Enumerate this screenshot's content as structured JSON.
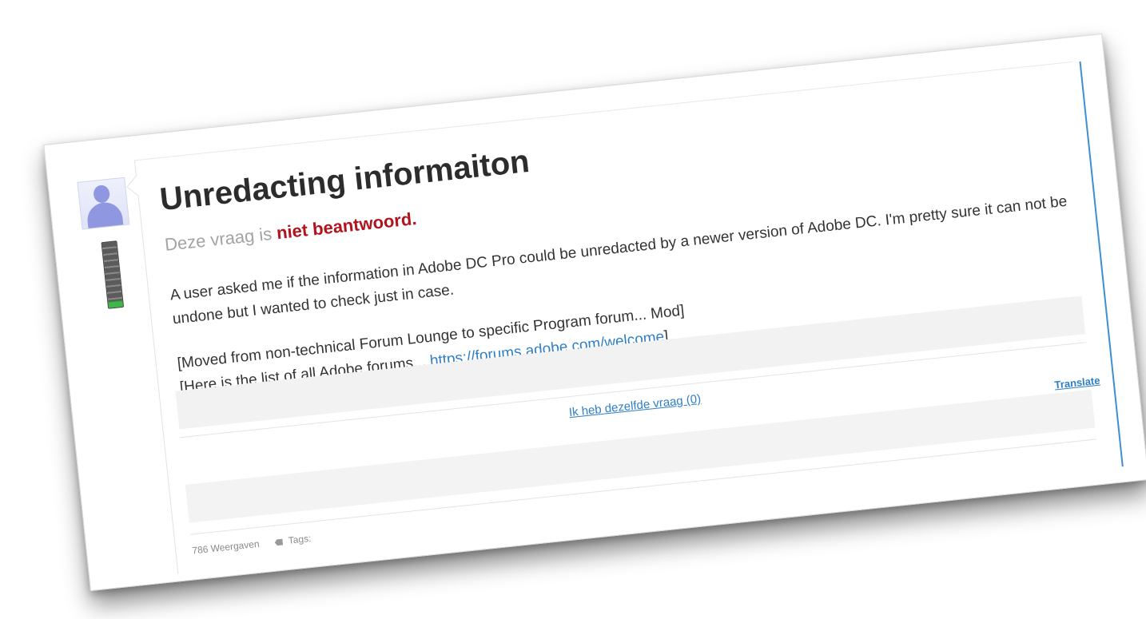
{
  "post": {
    "title": "Unredacting informaiton",
    "status_prefix": "Deze vraag is",
    "status_value": "niet beantwoord.",
    "body_line1": "A user asked me if the information in Adobe DC Pro could be unredacted by a newer version of Adobe DC. I'm pretty sure it can not be undone but I wanted to check just in case.",
    "moved_note": "[Moved from non-technical Forum Lounge to specific Program forum... Mod]",
    "forums_prefix": "[Here is the list of all Adobe forums...",
    "forums_link": "https://forums.adobe.com/welcome",
    "forums_suffix": "]",
    "same_question": "Ik heb dezelfde vraag (0)",
    "translate": "Translate",
    "views": "786 Weergaven",
    "tags_label": "Tags:"
  },
  "author": {
    "level_fraction": 0.08,
    "icon": "user-avatar-icon"
  },
  "colors": {
    "accent": "#2f7fc4",
    "status_red": "#b0141d",
    "rule_blue": "#3c8fd1"
  }
}
